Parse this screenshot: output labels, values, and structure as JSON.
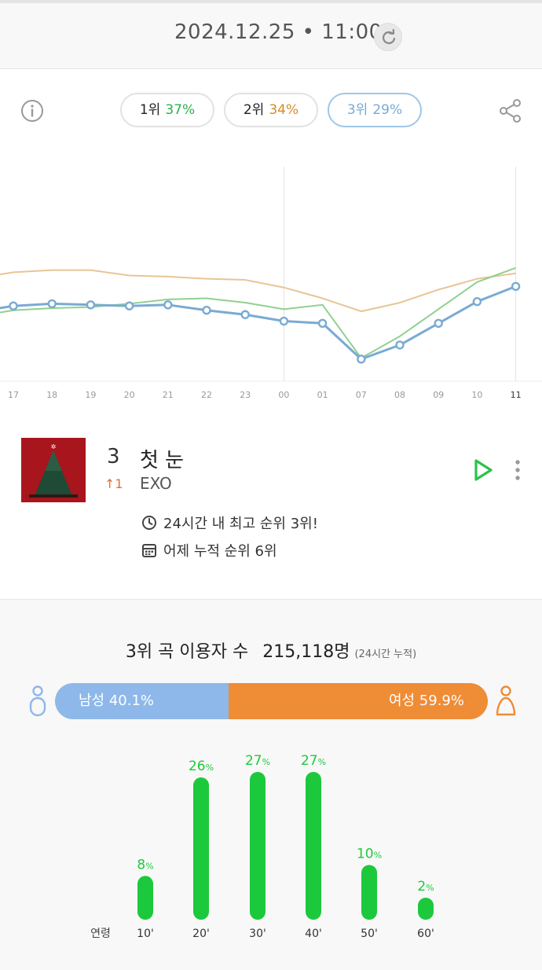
{
  "header": {
    "datetime": "2024.12.25 • 11:00",
    "refresh_icon": "refresh-icon"
  },
  "toolbar": {
    "info_icon": "info-icon",
    "share_icon": "share-icon",
    "pills": [
      {
        "rank": "1위",
        "pct": "37%",
        "color": "#2bb34a"
      },
      {
        "rank": "2위",
        "pct": "34%",
        "color": "#d68a2a"
      },
      {
        "rank": "3위",
        "pct": "29%",
        "color": "#7aaad3"
      }
    ]
  },
  "chart_data": {
    "type": "line",
    "x": [
      "17",
      "18",
      "19",
      "20",
      "21",
      "22",
      "23",
      "00",
      "01",
      "07",
      "08",
      "09",
      "10",
      "11"
    ],
    "series": [
      {
        "values": [
          44,
          46,
          46,
          41,
          40,
          38,
          37,
          30,
          20,
          8,
          16,
          28,
          38,
          43
        ],
        "color": "#e7c595"
      },
      {
        "values": [
          9,
          11,
          12,
          15,
          19,
          20,
          16,
          10,
          14,
          -35,
          -15,
          10,
          35,
          48
        ],
        "color": "#8fd18f"
      },
      {
        "values": [
          13,
          15,
          14,
          13,
          14,
          9,
          5,
          -1,
          -3,
          -36,
          -23,
          -3,
          17,
          31
        ],
        "color": "#7aaad3"
      }
    ],
    "ylim": [
      -60,
      150
    ],
    "grid": false,
    "highlight_x": [
      "00",
      "11"
    ]
  },
  "song": {
    "rank": "3",
    "change": "↑1",
    "title": "첫 눈",
    "artist": "EXO",
    "stat_best": "24시간 내 최고 순위 3위!",
    "stat_yesterday": "어제 누적 순위 6위",
    "colors": {
      "play": "#2bc24a",
      "change": "#e0703a"
    }
  },
  "users": {
    "heading": "3위 곡 이용자 수",
    "count": "215,118명",
    "note": "(24시간 누적)",
    "male_label": "남성 40.1%",
    "female_label": "여성 59.9%",
    "male_fraction": 0.401,
    "age_label": "연령",
    "ages": [
      {
        "label": "10'",
        "value": 8,
        "pct": "8",
        "unit": "%"
      },
      {
        "label": "20'",
        "value": 26,
        "pct": "26",
        "unit": "%"
      },
      {
        "label": "30'",
        "value": 27,
        "pct": "27",
        "unit": "%"
      },
      {
        "label": "40'",
        "value": 27,
        "pct": "27",
        "unit": "%"
      },
      {
        "label": "50'",
        "value": 10,
        "pct": "10",
        "unit": "%"
      },
      {
        "label": "60'",
        "value": 2,
        "pct": "2",
        "unit": "%"
      }
    ],
    "bar_color": "#1dc93c"
  }
}
